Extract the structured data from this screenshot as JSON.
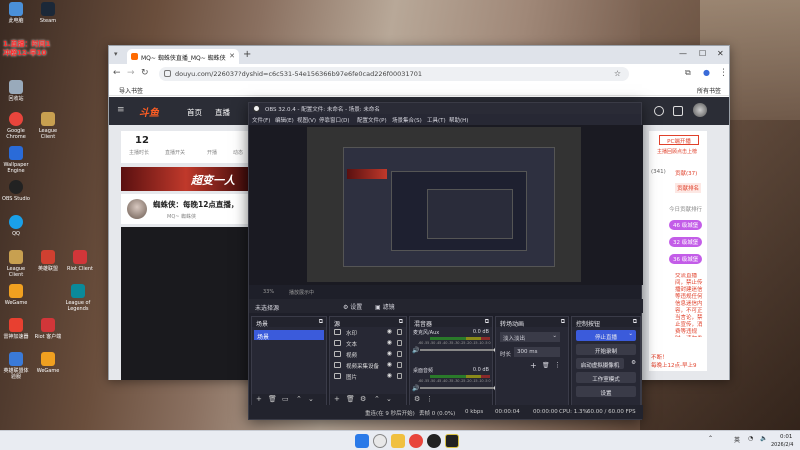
{
  "desktop": {
    "notice": [
      "1.直播：时间1",
      "冲榜12-早10"
    ],
    "icons": [
      {
        "label": "此电脑",
        "color": "#4a90d9"
      },
      {
        "label": "Steam",
        "color": "#1b2838"
      },
      {
        "label": "回收站",
        "color": "#9ab"
      },
      {
        "label": "Google Chrome",
        "color": "#e8453c"
      },
      {
        "label": "League Client",
        "color": "#c8a050"
      },
      {
        "label": "Wallpaper Engine",
        "color": "#2a6bd8"
      },
      {
        "label": "OBS Studio",
        "color": "#222"
      },
      {
        "label": "QQ",
        "color": "#1aa0e8"
      },
      {
        "label": "League Client",
        "color": "#c8a050"
      },
      {
        "label": "英雄联盟",
        "color": "#d04030"
      },
      {
        "label": "Riot Client",
        "color": "#d13639"
      },
      {
        "label": "WeGame",
        "color": "#f0a020"
      },
      {
        "label": "League of Legends",
        "color": "#0a8a9a"
      },
      {
        "label": "雷神加速器",
        "color": "#e84030"
      },
      {
        "label": "Riot 客户端",
        "color": "#d13639"
      },
      {
        "label": "英雄联盟体验服",
        "color": "#3a7ad8"
      },
      {
        "label": "WeGame",
        "color": "#f0a020"
      }
    ]
  },
  "chrome": {
    "tab_title": "MQ~ 蜘蛛侠直播_MQ~ 蜘蛛侠",
    "url": "douyu.com/226037?dyshid=c6c531-54e156366b97e6fe0cad226f00031701",
    "bookmark": "导入书签",
    "bookmarks_right": "所有书签",
    "page": {
      "nav": [
        "首页",
        "直播"
      ],
      "stats": [
        {
          "value": "12",
          "label": "主播时长"
        },
        {
          "label": "直播开关"
        },
        {
          "label": "开播"
        },
        {
          "label": "动态"
        }
      ],
      "banner_text": "超变一人",
      "streamer_title": "蜘蛛侠：每晚12点直播，",
      "streamer_sub": "MQ~ 蜘蛛侠",
      "side_top": "PC端开播",
      "side_sub": "主播回顾点击上榜",
      "side_row": [
        "(341)",
        "贡献(37)",
        "贡献排名"
      ],
      "side_today": "今日贡献排行",
      "pills": [
        {
          "n": "46",
          "text": "级城堡"
        },
        {
          "n": "32",
          "text": "级城堡"
        },
        {
          "n": "36",
          "text": "级城堡"
        }
      ],
      "side_notice": "交流直播间，禁止传播封建迷信等违规任何信息迷信内容，不可正当言论，禁止宣传，消费等违规时，请勿参与，理性消费，谨防上当！",
      "side_bottom": [
        "不断！",
        "每晚上12点-早上9"
      ]
    }
  },
  "obs": {
    "title": "OBS 32.0.4 - 配置文件: 未命名 - 场景: 未命名",
    "menu": [
      "文件(F)",
      "编辑(E)",
      "视图(V)",
      "停靠窗口(D)",
      "配置文件(P)",
      "场景集合(S)",
      "工具(T)",
      "帮助(H)"
    ],
    "zoom": "33%",
    "preview_label": "播放展示中",
    "scene_label": "未选择源",
    "filters": "滤镜",
    "properties": "设置",
    "docks": {
      "scenes": {
        "title": "场景",
        "items": [
          "场景"
        ]
      },
      "sources": {
        "title": "源",
        "items": [
          "水印",
          "文本",
          "视频",
          "视频采集设备",
          "图片"
        ]
      },
      "mixer": {
        "title": "混音器",
        "channels": [
          {
            "name": "麦克风/Aux",
            "db": "0.0 dB"
          },
          {
            "name": "桌面音频",
            "db": "0.0 dB"
          }
        ],
        "ticks": "-60 -55 -50 -45 -40 -35 -30 -25 -20 -15 -10 -5 0"
      },
      "transitions": {
        "title": "转场动画",
        "type": "淡入淡出",
        "duration_label": "时长",
        "duration": "300 ms"
      },
      "controls": {
        "title": "控制按钮",
        "buttons": [
          "停止直播",
          "开始录制",
          "启动虚拟摄像机",
          "工作室模式",
          "设置"
        ]
      }
    },
    "status": {
      "reconnect": "重连(在 9 秒后开始)",
      "dropped": "丢帧 0 (0.0%)",
      "bitrate": "0 kbps",
      "live_time": "00:00:04",
      "rec_time": "00:00:00",
      "cpu": "CPU: 1.3%",
      "fps": "60.00 / 60.00 FPS"
    }
  },
  "taskbar": {
    "tray_lang": "英",
    "time": "0:01",
    "date": "2026/2/4"
  }
}
